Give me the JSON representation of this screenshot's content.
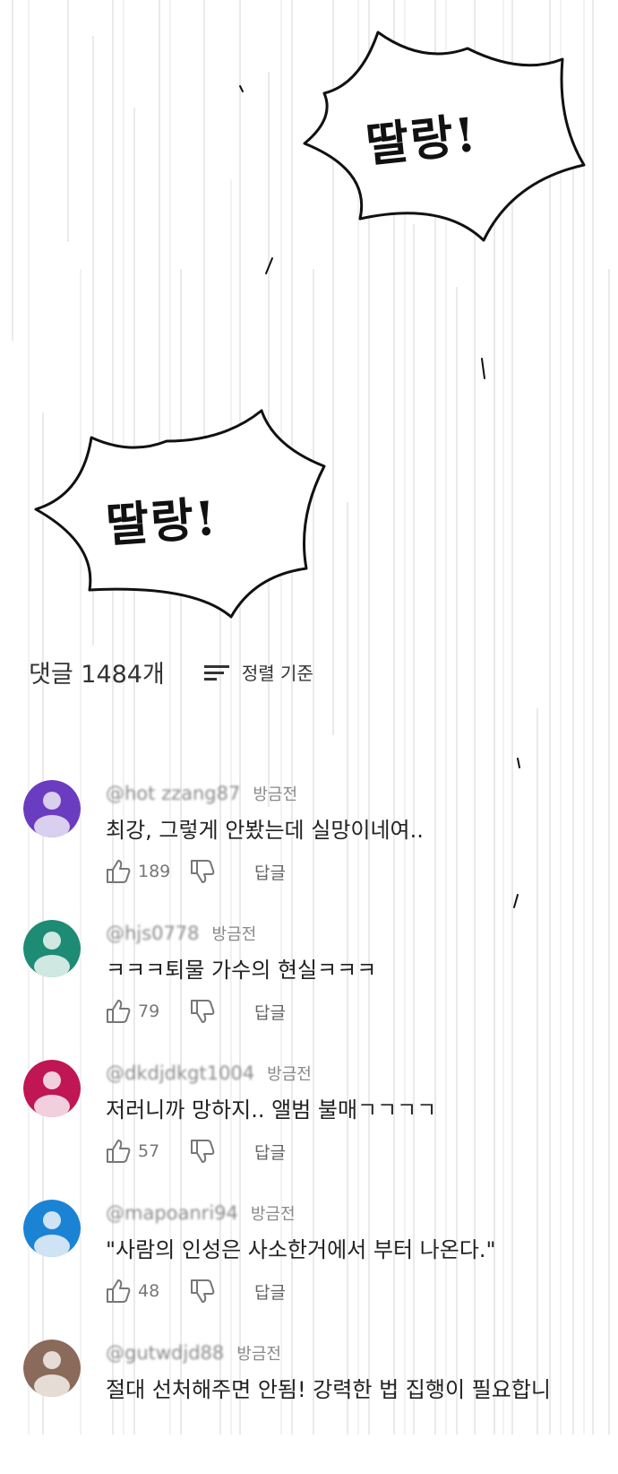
{
  "panel": {
    "sfx_top": "딸랑!",
    "sfx_bottom": "딸랑!"
  },
  "comments_section": {
    "count_label": "댓글 1484개",
    "sort_label": "정렬 기준",
    "sort_icon": "sort-icon"
  },
  "comments": [
    {
      "handle": "@hot zzang87",
      "time": "방금전",
      "text": "최강, 그렇게 안봤는데 실망이네여..",
      "likes": "189",
      "reply": "답글",
      "avatar_color": "#6a3cc0"
    },
    {
      "handle": "@hjs0778",
      "time": "방금전",
      "text": "ㅋㅋㅋ퇴물 가수의 현실ㅋㅋㅋ",
      "likes": "79",
      "reply": "답글",
      "avatar_color": "#1e8b74"
    },
    {
      "handle": "@dkdjdkgt1004",
      "time": "방금전",
      "text": "저러니까 망하지.. 앨범 불매ㄱㄱㄱㄱ",
      "likes": "57",
      "reply": "답글",
      "avatar_color": "#c01653"
    },
    {
      "handle": "@mapoanri94",
      "time": "방금전",
      "text": "\"사람의 인성은 사소한거에서 부터 나온다.\"",
      "likes": "48",
      "reply": "답글",
      "avatar_color": "#1b83d4"
    },
    {
      "handle": "@gutwdjd88",
      "time": "방금전",
      "text": "절대 선처해주면 안됨! 강력한 법 집행이 필요합니",
      "likes": "",
      "reply": "",
      "avatar_color": "#8a6a5a"
    }
  ],
  "colors": {
    "speed_line": "#d6d6d6",
    "text_primary": "#222222",
    "text_secondary": "#777777"
  }
}
